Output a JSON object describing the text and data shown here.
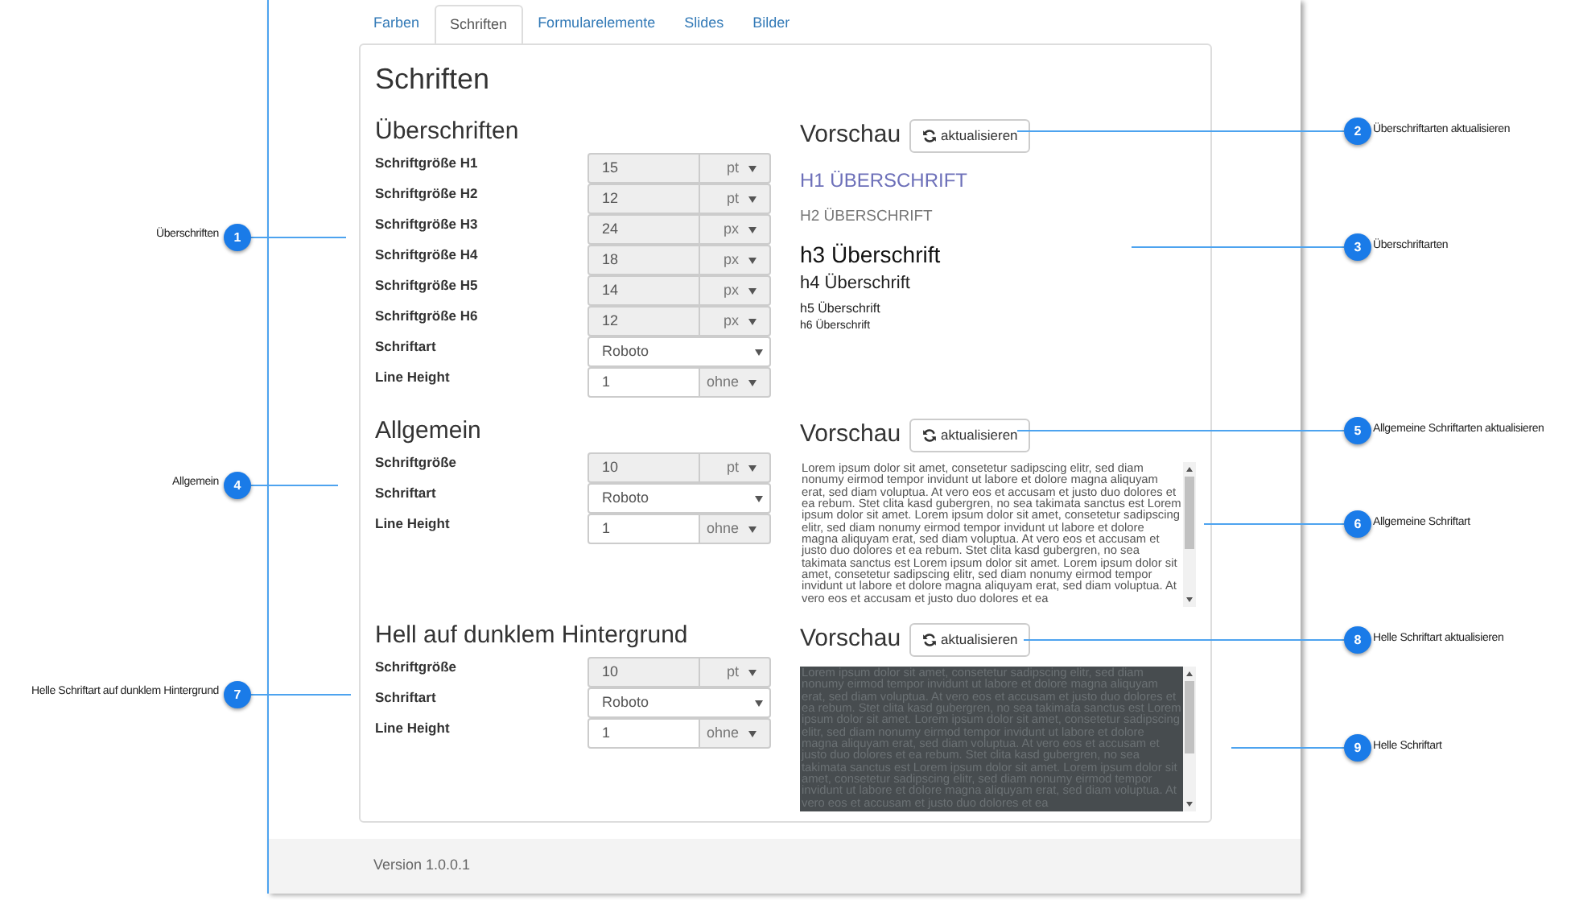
{
  "tabs": [
    {
      "label": "Farben",
      "selected": false
    },
    {
      "label": "Schriften",
      "selected": true
    },
    {
      "label": "Formularelemente",
      "selected": false
    },
    {
      "label": "Slides",
      "selected": false
    },
    {
      "label": "Bilder",
      "selected": false
    }
  ],
  "page_title": "Schriften",
  "sections": [
    {
      "title": "Überschriften",
      "fields": [
        {
          "kind": "size",
          "label": "Schriftgröße H1",
          "value": "15",
          "unit": "pt",
          "disabled": true
        },
        {
          "kind": "size",
          "label": "Schriftgröße H2",
          "value": "12",
          "unit": "pt",
          "disabled": true
        },
        {
          "kind": "size",
          "label": "Schriftgröße H3",
          "value": "24",
          "unit": "px",
          "disabled": true
        },
        {
          "kind": "size",
          "label": "Schriftgröße H4",
          "value": "18",
          "unit": "px",
          "disabled": true
        },
        {
          "kind": "size",
          "label": "Schriftgröße H5",
          "value": "14",
          "unit": "px",
          "disabled": true
        },
        {
          "kind": "size",
          "label": "Schriftgröße H6",
          "value": "12",
          "unit": "px",
          "disabled": true
        },
        {
          "kind": "select",
          "label": "Schriftart",
          "value": "Roboto"
        },
        {
          "kind": "size",
          "label": "Line Height",
          "value": "1",
          "unit": "ohne",
          "disabled": false
        }
      ],
      "preview": {
        "title": "Vorschau",
        "button": "aktualisieren",
        "kind": "headings",
        "headings": [
          "H1 ÜBERSCHRIFT",
          "H2 ÜBERSCHRIFT",
          "h3 Überschrift",
          "h4 Überschrift",
          "h5 Überschrift",
          "h6 Überschrift"
        ]
      }
    },
    {
      "title": "Allgemein",
      "fields": [
        {
          "kind": "size",
          "label": "Schriftgröße",
          "value": "10",
          "unit": "pt",
          "disabled": true
        },
        {
          "kind": "select",
          "label": "Schriftart",
          "value": "Roboto"
        },
        {
          "kind": "size",
          "label": "Line Height",
          "value": "1",
          "unit": "ohne",
          "disabled": false
        }
      ],
      "preview": {
        "title": "Vorschau",
        "button": "aktualisieren",
        "kind": "text",
        "dark": false,
        "text": "Lorem ipsum dolor sit amet, consetetur sadipscing elitr, sed diam nonumy eirmod tempor invidunt ut labore et dolore magna aliquyam erat, sed diam voluptua. At vero eos et accusam et justo duo dolores et ea rebum. Stet clita kasd gubergren, no sea takimata sanctus est Lorem ipsum dolor sit amet. Lorem ipsum dolor sit amet, consetetur sadipscing elitr, sed diam nonumy eirmod tempor invidunt ut labore et dolore magna aliquyam erat, sed diam voluptua. At vero eos et accusam et justo duo dolores et ea rebum. Stet clita kasd gubergren, no sea takimata sanctus est Lorem ipsum dolor sit amet. Lorem ipsum dolor sit amet, consetetur sadipscing elitr, sed diam nonumy eirmod tempor invidunt ut labore et dolore magna aliquyam erat, sed diam voluptua. At vero eos et accusam et justo duo dolores et ea"
      }
    },
    {
      "title": "Hell auf dunklem Hintergrund",
      "fields": [
        {
          "kind": "size",
          "label": "Schriftgröße",
          "value": "10",
          "unit": "pt",
          "disabled": true
        },
        {
          "kind": "select",
          "label": "Schriftart",
          "value": "Roboto"
        },
        {
          "kind": "size",
          "label": "Line Height",
          "value": "1",
          "unit": "ohne",
          "disabled": false
        }
      ],
      "preview": {
        "title": "Vorschau",
        "button": "aktualisieren",
        "kind": "text",
        "dark": true,
        "text": "Lorem ipsum dolor sit amet, consetetur sadipscing elitr, sed diam nonumy eirmod tempor invidunt ut labore et dolore magna aliquyam erat, sed diam voluptua. At vero eos et accusam et justo duo dolores et ea rebum. Stet clita kasd gubergren, no sea takimata sanctus est Lorem ipsum dolor sit amet. Lorem ipsum dolor sit amet, consetetur sadipscing elitr, sed diam nonumy eirmod tempor invidunt ut labore et dolore magna aliquyam erat, sed diam voluptua. At vero eos et accusam et justo duo dolores et ea rebum. Stet clita kasd gubergren, no sea takimata sanctus est Lorem ipsum dolor sit amet. Lorem ipsum dolor sit amet, consetetur sadipscing elitr, sed diam nonumy eirmod tempor invidunt ut labore et dolore magna aliquyam erat, sed diam voluptua. At vero eos et accusam et justo duo dolores et ea"
      }
    }
  ],
  "footer": "Version 1.0.0.1",
  "callouts": [
    {
      "number": "1",
      "label": "Überschriften",
      "kind": "left"
    },
    {
      "number": "2",
      "label": "Überschriftarten aktualisieren",
      "kind": "right"
    },
    {
      "number": "3",
      "label": "Überschriftarten",
      "kind": "right"
    },
    {
      "number": "4",
      "label": "Allgemein",
      "kind": "left"
    },
    {
      "number": "5",
      "label": "Allgemeine Schriftarten aktualisieren",
      "kind": "right"
    },
    {
      "number": "6",
      "label": "Allgemeine Schriftart",
      "kind": "right"
    },
    {
      "number": "7",
      "label": "Helle Schriftart auf dunklem Hintergrund",
      "kind": "left"
    },
    {
      "number": "8",
      "label": "Helle Schriftart aktualisieren",
      "kind": "right"
    },
    {
      "number": "9",
      "label": "Helle Schriftart",
      "kind": "right"
    }
  ]
}
